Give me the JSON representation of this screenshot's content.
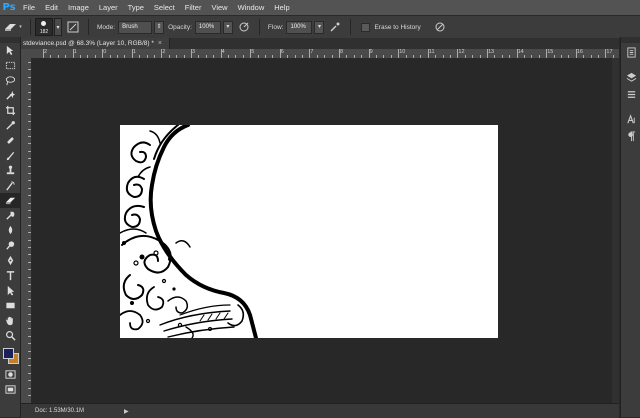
{
  "app": {
    "logo": "Ps"
  },
  "menu": [
    "File",
    "Edit",
    "Image",
    "Layer",
    "Type",
    "Select",
    "Filter",
    "View",
    "Window",
    "Help"
  ],
  "options": {
    "brush_size": "182",
    "mode_label": "Mode:",
    "mode_value": "Brush",
    "opacity_label": "Opacity:",
    "opacity_value": "100%",
    "flow_label": "Flow:",
    "flow_value": "100%",
    "erase_history_label": "Erase to History"
  },
  "document": {
    "tab_title": "stdeviance.psd @ 68.3% (Layer 10, RGB/8) *"
  },
  "ruler": {
    "h_labels": [
      "2",
      "1",
      "0",
      "1",
      "2",
      "3",
      "4",
      "5",
      "6",
      "7",
      "8",
      "9",
      "10",
      "11",
      "12",
      "13",
      "14",
      "15",
      "16",
      "17"
    ]
  },
  "status": {
    "doc_info": "Doc: 1.53M/30.1M"
  },
  "colors": {
    "foreground": "#1a1f5e",
    "background": "#c3802a"
  },
  "icons": {
    "tools": [
      "move-icon",
      "marquee-icon",
      "lasso-icon",
      "quick-select-icon",
      "crop-icon",
      "eyedropper-icon",
      "spot-heal-icon",
      "brush-icon",
      "clone-stamp-icon",
      "history-brush-icon",
      "eraser-icon",
      "gradient-icon",
      "blur-icon",
      "dodge-icon",
      "pen-icon",
      "type-icon",
      "path-select-icon",
      "rectangle-icon",
      "hand-icon",
      "zoom-icon"
    ]
  }
}
